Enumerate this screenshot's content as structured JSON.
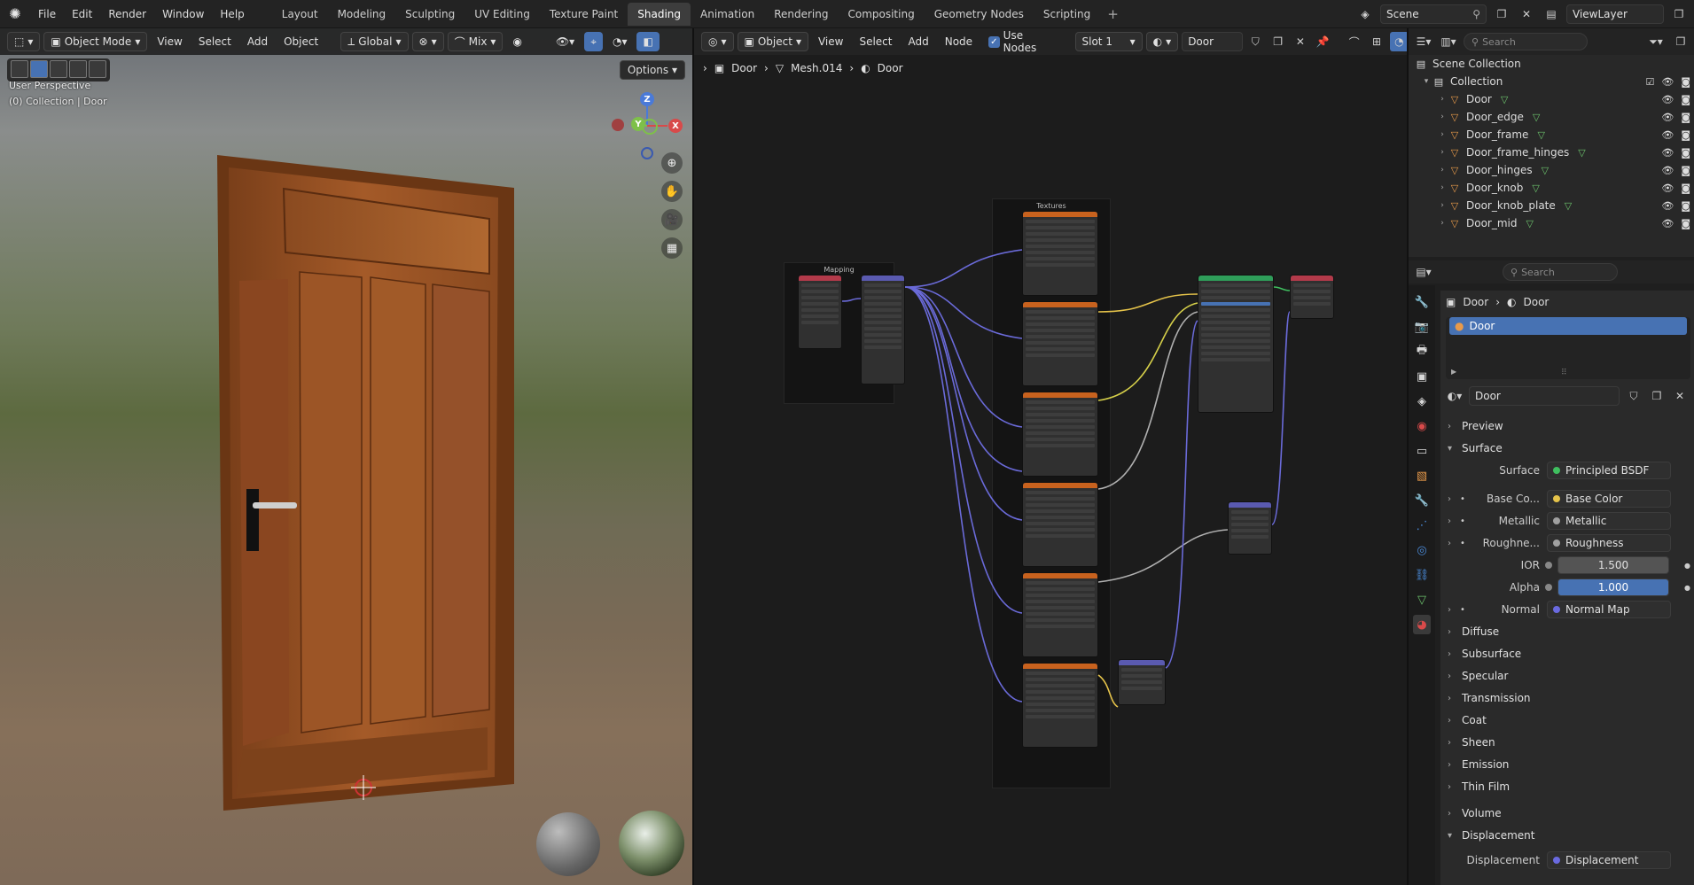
{
  "menu": {
    "items": [
      "File",
      "Edit",
      "Render",
      "Window",
      "Help"
    ]
  },
  "workspaces": {
    "tabs": [
      "Layout",
      "Modeling",
      "Sculpting",
      "UV Editing",
      "Texture Paint",
      "Shading",
      "Animation",
      "Rendering",
      "Compositing",
      "Geometry Nodes",
      "Scripting"
    ],
    "active": "Shading",
    "add": "+"
  },
  "topright": {
    "scene": "Scene",
    "viewlayer": "ViewLayer"
  },
  "viewport": {
    "mode": "Object Mode",
    "menus": [
      "View",
      "Select",
      "Add",
      "Object"
    ],
    "orientation": "Global",
    "shading_mix": "Mix",
    "options": "Options",
    "info_line1": "User Perspective",
    "info_line2": "(0) Collection | Door",
    "axes": {
      "x": "X",
      "y": "Y",
      "z": "Z"
    }
  },
  "node_editor": {
    "object_type": "Object",
    "menus": [
      "View",
      "Select",
      "Add",
      "Node"
    ],
    "use_nodes_label": "Use Nodes",
    "slot": "Slot 1",
    "material": "Door",
    "breadcrumb": [
      "Door",
      "Mesh.014",
      "Door"
    ],
    "frames": {
      "textures": "Textures",
      "mapping": "Mapping"
    }
  },
  "outliner": {
    "search_placeholder": "Search",
    "root": "Scene Collection",
    "collection": "Collection",
    "objects": [
      "Door",
      "Door_edge",
      "Door_frame",
      "Door_frame_hinges",
      "Door_hinges",
      "Door_knob",
      "Door_knob_plate",
      "Door_mid"
    ]
  },
  "properties": {
    "search_placeholder": "Search",
    "breadcrumb": [
      "Door",
      "Door"
    ],
    "slot_material": "Door",
    "material_name": "Door",
    "panels": {
      "preview": "Preview",
      "surface": "Surface",
      "diffuse": "Diffuse",
      "subsurface": "Subsurface",
      "specular": "Specular",
      "transmission": "Transmission",
      "coat": "Coat",
      "sheen": "Sheen",
      "emission": "Emission",
      "thin_film": "Thin Film",
      "volume": "Volume",
      "displacement": "Displacement"
    },
    "surface_rows": [
      {
        "label": "Surface",
        "value": "Principled BSDF",
        "socket": "#3fbf5f"
      },
      {
        "label": "Base Co...",
        "value": "Base Color",
        "socket": "#e5c34a"
      },
      {
        "label": "Metallic",
        "value": "Metallic",
        "socket": "#a0a0a0"
      },
      {
        "label": "Roughne...",
        "value": "Roughness",
        "socket": "#a0a0a0"
      }
    ],
    "ior": {
      "label": "IOR",
      "value": "1.500"
    },
    "alpha": {
      "label": "Alpha",
      "value": "1.000"
    },
    "normal": {
      "label": "Normal",
      "value": "Normal Map",
      "socket": "#6a6ae0"
    },
    "displacement_row": {
      "label": "Displacement",
      "value": "Displacement",
      "socket": "#6a6ae0"
    }
  },
  "colors": {
    "accent": "#4772b3",
    "header": "#232323",
    "panel": "#2a2a2a"
  }
}
